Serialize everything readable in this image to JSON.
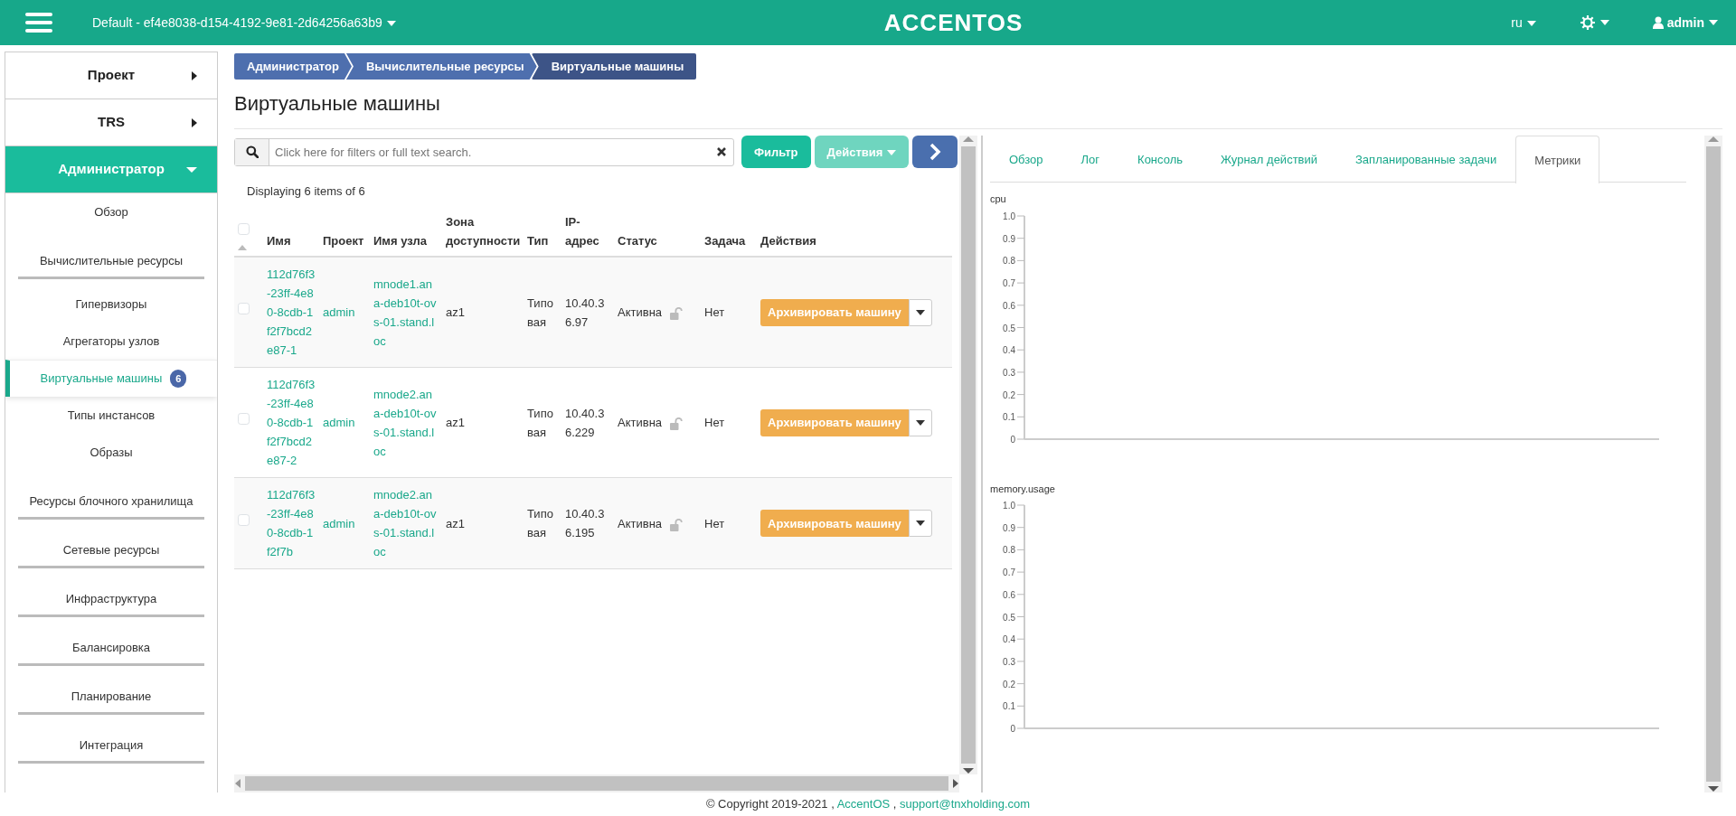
{
  "header": {
    "project": "Default - ef4e8038-d154-4192-9e81-2d64256a63b9",
    "logo": "ACCENTOS",
    "language": "ru",
    "user": "admin"
  },
  "sidebar": [
    {
      "label": "Проект",
      "expanded": false
    },
    {
      "label": "TRS",
      "expanded": false
    },
    {
      "label": "Администратор",
      "expanded": true,
      "children": [
        {
          "kind": "link",
          "label": "Обзор",
          "selected": false
        },
        {
          "kind": "group",
          "label": "Вычислительные ресурсы",
          "children": [
            {
              "kind": "link",
              "label": "Гипервизоры",
              "selected": false
            },
            {
              "kind": "link",
              "label": "Агрегаторы узлов",
              "selected": false
            },
            {
              "kind": "link",
              "label": "Виртуальные машины",
              "selected": true,
              "badge": "6"
            },
            {
              "kind": "link",
              "label": "Типы инстансов",
              "selected": false
            },
            {
              "kind": "link",
              "label": "Образы",
              "selected": false
            }
          ]
        },
        {
          "kind": "group",
          "label": "Ресурсы блочного хранилища"
        },
        {
          "kind": "group",
          "label": "Сетевые ресурсы"
        },
        {
          "kind": "group",
          "label": "Инфраструктура"
        },
        {
          "kind": "group",
          "label": "Балансировка"
        },
        {
          "kind": "group",
          "label": "Планирование"
        },
        {
          "kind": "group",
          "label": "Интеграция"
        }
      ]
    }
  ],
  "breadcrumb": [
    {
      "label": "Администратор",
      "selected": false
    },
    {
      "label": "Вычислительные ресурсы",
      "selected": false
    },
    {
      "label": "Виртуальные машины",
      "selected": true
    }
  ],
  "page_title": "Виртуальные машины",
  "toolbar": {
    "search_placeholder": "Click here for filters or full text search.",
    "filter_button": "Фильтр",
    "actions_button": "Действия",
    "actions_disabled": true
  },
  "summary": "Displaying 6 items of 6",
  "table": {
    "all_checked": false,
    "columns": [
      "Имя",
      "Проект",
      "Имя узла",
      "Зона доступности",
      "Тип",
      "IP-адрес",
      "Статус",
      "Задача",
      "Действия"
    ],
    "rows": [
      {
        "checked": false,
        "name": "112d76f3-23ff-4e80-8cdb-1f2f7bcd2e87-1",
        "project": "admin",
        "host": "mnode1.ana-deb10t-ovs-01.stand.loc",
        "zone": "az1",
        "type": "Типовая",
        "ip": "10.40.36.97",
        "status": "Активна",
        "locked": false,
        "task": "Нет",
        "action": "Архивировать машину"
      },
      {
        "checked": false,
        "name": "112d76f3-23ff-4e80-8cdb-1f2f7bcd2e87-2",
        "project": "admin",
        "host": "mnode2.ana-deb10t-ovs-01.stand.loc",
        "zone": "az1",
        "type": "Типовая",
        "ip": "10.40.36.229",
        "status": "Активна",
        "locked": false,
        "task": "Нет",
        "action": "Архивировать машину"
      },
      {
        "checked": false,
        "name": "112d76f3-23ff-4e80-8cdb-1f2f7b",
        "project": "admin",
        "host": "mnode2.ana-deb10t-ovs-01.stand.loc",
        "zone": "az1",
        "type": "Типовая",
        "ip": "10.40.36.195",
        "status": "Активна",
        "locked": false,
        "task": "Нет",
        "action": "Архивировать машину"
      }
    ]
  },
  "detail_tabs": [
    {
      "label": "Обзор",
      "selected": false
    },
    {
      "label": "Лог",
      "selected": false
    },
    {
      "label": "Консоль",
      "selected": false
    },
    {
      "label": "Журнал действий",
      "selected": false
    },
    {
      "label": "Запланированные задачи",
      "selected": false
    },
    {
      "label": "Метрики",
      "selected": true
    }
  ],
  "charts": [
    {
      "kind": "empty_plot",
      "title": "cpu",
      "axis_labels": [
        "1.0",
        "0.9",
        "0.8",
        "0.7",
        "0.6",
        "0.5",
        "0.4",
        "0.3",
        "0.2",
        "0.1",
        "0"
      ]
    },
    {
      "kind": "empty_plot",
      "title": "memory.usage",
      "axis_labels": [
        "1.0",
        "0.9",
        "0.8",
        "0.7",
        "0.6",
        "0.5",
        "0.4",
        "0.3",
        "0.2",
        "0.1",
        "0"
      ]
    }
  ],
  "footer": [
    {
      "kind": "text",
      "text": "© Copyright 2019-2021 ,"
    },
    {
      "kind": "link",
      "text": "AccentOS"
    },
    {
      "kind": "text",
      "text": ","
    },
    {
      "kind": "link",
      "text": "support@tnxholding.com"
    }
  ]
}
